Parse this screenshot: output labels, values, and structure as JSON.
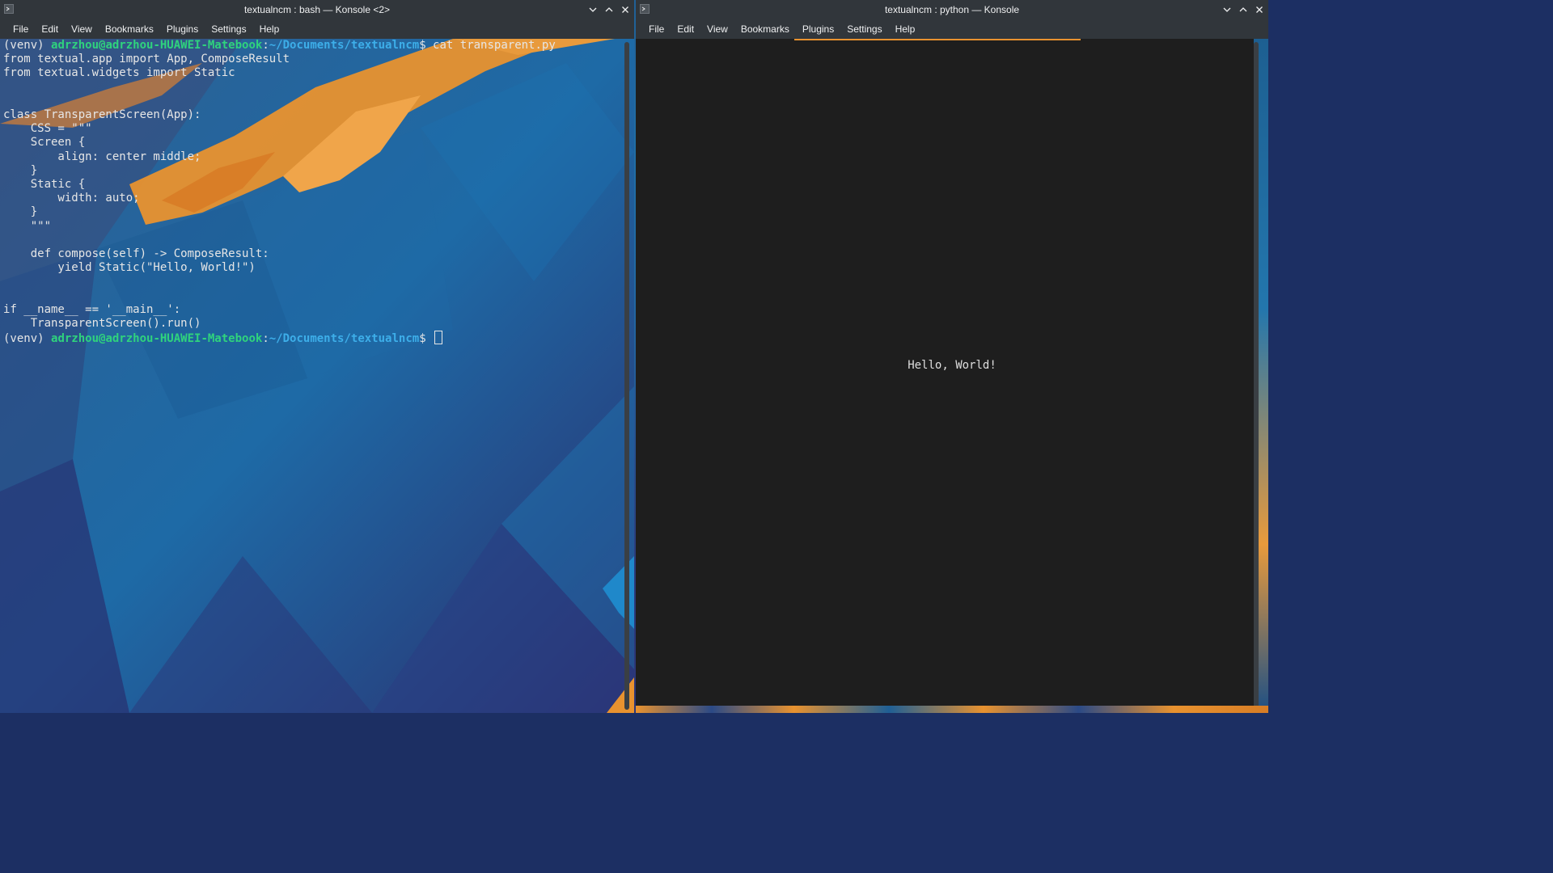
{
  "left_window": {
    "title": "textualncm : bash — Konsole <2>",
    "menu": [
      "File",
      "Edit",
      "View",
      "Bookmarks",
      "Plugins",
      "Settings",
      "Help"
    ],
    "prompt": {
      "venv": "(venv) ",
      "user_host": "adrzhou@adrzhou-HUAWEI-Matebook",
      "colon": ":",
      "path": "~/Documents/textualncm",
      "dollar": "$ "
    },
    "command": "cat transparent.py",
    "file_lines": [
      "from textual.app import App, ComposeResult",
      "from textual.widgets import Static",
      "",
      "",
      "class TransparentScreen(App):",
      "    CSS = \"\"\"",
      "    Screen {",
      "        align: center middle;",
      "    }",
      "    Static {",
      "        width: auto;",
      "    }",
      "    \"\"\"",
      "",
      "    def compose(self) -> ComposeResult:",
      "        yield Static(\"Hello, World!\")",
      "",
      "",
      "if __name__ == '__main__':",
      "    TransparentScreen().run()"
    ]
  },
  "right_window": {
    "title": "textualncm : python — Konsole",
    "menu": [
      "File",
      "Edit",
      "View",
      "Bookmarks",
      "Plugins",
      "Settings",
      "Help"
    ],
    "output_text": "Hello, World!"
  },
  "colors": {
    "titlebar": "#31363b",
    "prompt_user": "#2fd37d",
    "prompt_path": "#3daee9",
    "terminal_bg": "#1e1e1e",
    "accent_orange": "#e8922f"
  }
}
